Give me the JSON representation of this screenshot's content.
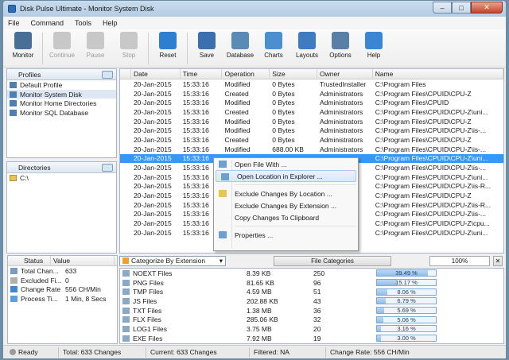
{
  "window": {
    "title": "Disk Pulse Ultimate - Monitor System Disk"
  },
  "menu": [
    "File",
    "Command",
    "Tools",
    "Help"
  ],
  "toolbar": [
    {
      "label": "Monitor",
      "icon": "monitor-icon",
      "enabled": true,
      "color": "#4a6f96"
    },
    {
      "label": "Continue",
      "icon": "play-icon",
      "enabled": false
    },
    {
      "label": "Pause",
      "icon": "pause-icon",
      "enabled": false
    },
    {
      "label": "Stop",
      "icon": "stop-icon",
      "enabled": false
    },
    {
      "label": "Reset",
      "icon": "reset-icon",
      "enabled": true,
      "color": "#2f7fd0"
    },
    {
      "label": "Save",
      "icon": "save-icon",
      "enabled": true,
      "color": "#3a6fb0"
    },
    {
      "label": "Database",
      "icon": "database-icon",
      "enabled": true,
      "color": "#5a8ab6"
    },
    {
      "label": "Charts",
      "icon": "charts-icon",
      "enabled": true,
      "color": "#4c8fd1"
    },
    {
      "label": "Layouts",
      "icon": "layouts-icon",
      "enabled": true,
      "color": "#3d7cc0"
    },
    {
      "label": "Options",
      "icon": "options-icon",
      "enabled": true,
      "color": "#5a7fa6"
    },
    {
      "label": "Help",
      "icon": "help-icon",
      "enabled": true,
      "color": "#3a86d4"
    }
  ],
  "profiles": {
    "header": "Profiles",
    "items": [
      "Default Profile",
      "Monitor System Disk",
      "Monitor Home Directories",
      "Monitor SQL Database"
    ],
    "selected": 1
  },
  "directories": {
    "header": "Directories",
    "items": [
      "C:\\"
    ]
  },
  "grid": {
    "columns": [
      "Date",
      "Time",
      "Operation",
      "Size",
      "Owner",
      "Name"
    ],
    "rows": [
      {
        "status": "yellow",
        "date": "20-Jan-2015",
        "time": "15:33:16",
        "op": "Modified",
        "size": "0 Bytes",
        "owner": "TrustedInstaller",
        "name": "C:\\Program Files"
      },
      {
        "status": "green",
        "date": "20-Jan-2015",
        "time": "15:33:16",
        "op": "Created",
        "size": "0 Bytes",
        "owner": "Administrators",
        "name": "C:\\Program Files\\CPUID\\CPU-Z"
      },
      {
        "status": "yellow",
        "date": "20-Jan-2015",
        "time": "15:33:16",
        "op": "Modified",
        "size": "0 Bytes",
        "owner": "Administrators",
        "name": "C:\\Program Files\\CPUID"
      },
      {
        "status": "green",
        "date": "20-Jan-2015",
        "time": "15:33:16",
        "op": "Created",
        "size": "0 Bytes",
        "owner": "Administrators",
        "name": "C:\\Program Files\\CPUID\\CPU-Z\\uni..."
      },
      {
        "status": "yellow",
        "date": "20-Jan-2015",
        "time": "15:33:16",
        "op": "Modified",
        "size": "0 Bytes",
        "owner": "Administrators",
        "name": "C:\\Program Files\\CPUID\\CPU-Z"
      },
      {
        "status": "yellow",
        "date": "20-Jan-2015",
        "time": "15:33:16",
        "op": "Modified",
        "size": "0 Bytes",
        "owner": "Administrators",
        "name": "C:\\Program Files\\CPUID\\CPU-Z\\is-..."
      },
      {
        "status": "green",
        "date": "20-Jan-2015",
        "time": "15:33:16",
        "op": "Created",
        "size": "0 Bytes",
        "owner": "Administrators",
        "name": "C:\\Program Files\\CPUID\\CPU-Z"
      },
      {
        "status": "yellow",
        "date": "20-Jan-2015",
        "time": "15:33:16",
        "op": "Modified",
        "size": "688.00 KB",
        "owner": "Administrators",
        "name": "C:\\Program Files\\CPUID\\CPU-Z\\is-..."
      },
      {
        "status": "orange",
        "date": "20-Jan-2015",
        "time": "15:33:16",
        "op": "",
        "size": "",
        "owner": "",
        "name": "C:\\Program Files\\CPUID\\CPU-Z\\uni...",
        "selected": true
      },
      {
        "status": "green",
        "date": "20-Jan-2015",
        "time": "15:33:16",
        "op": "",
        "size": "",
        "owner": "",
        "name": "C:\\Program Files\\CPUID\\CPU-Z\\is-..."
      },
      {
        "status": "green",
        "date": "20-Jan-2015",
        "time": "15:33:16",
        "op": "",
        "size": "",
        "owner": "",
        "name": "C:\\Program Files\\CPUID\\CPU-Z\\uni..."
      },
      {
        "status": "green",
        "date": "20-Jan-2015",
        "time": "15:33:16",
        "op": "",
        "size": "",
        "owner": "",
        "name": "C:\\Program Files\\CPUID\\CPU-Z\\is-R..."
      },
      {
        "status": "green",
        "date": "20-Jan-2015",
        "time": "15:33:16",
        "op": "",
        "size": "",
        "owner": "",
        "name": "C:\\Program Files\\CPUID\\CPU-Z"
      },
      {
        "status": "orange",
        "date": "20-Jan-2015",
        "time": "15:33:16",
        "op": "",
        "size": "",
        "owner": "",
        "name": "C:\\Program Files\\CPUID\\CPU-Z\\is-R..."
      },
      {
        "status": "orange",
        "date": "20-Jan-2015",
        "time": "15:33:16",
        "op": "",
        "size": "",
        "owner": "",
        "name": "C:\\Program Files\\CPUID\\CPU-Z\\is-..."
      },
      {
        "status": "yellow",
        "date": "20-Jan-2015",
        "time": "15:33:16",
        "op": "",
        "size": "",
        "owner": "",
        "name": "C:\\Program Files\\CPUID\\CPU-Z\\cpu..."
      },
      {
        "status": "yellow",
        "date": "20-Jan-2015",
        "time": "15:33:16",
        "op": "",
        "size": "",
        "owner": "",
        "name": "C:\\Program Files\\CPUID\\CPU-Z\\uni..."
      }
    ]
  },
  "context_menu": [
    {
      "label": "Open File With ...",
      "icon": "open-file-icon"
    },
    {
      "label": "Open Location in Explorer ...",
      "icon": "folder-open-icon",
      "hot": true
    },
    {
      "sep": true
    },
    {
      "label": "Exclude Changes By Location ...",
      "icon": "exclude-folder-icon"
    },
    {
      "label": "Exclude Changes By Extension ..."
    },
    {
      "label": "Copy Changes To Clipboard"
    },
    {
      "sep": true
    },
    {
      "label": "Properties ...",
      "icon": "properties-icon"
    }
  ],
  "stats": {
    "headers": [
      "Status",
      "Value"
    ],
    "rows": [
      {
        "icon": "total-changes-icon",
        "label": "Total Chan...",
        "value": "633"
      },
      {
        "icon": "excluded-files-icon",
        "label": "Excluded Fi...",
        "value": "0"
      },
      {
        "icon": "change-rate-icon",
        "label": "Change Rate",
        "value": "556 CH/Min"
      },
      {
        "icon": "process-time-icon",
        "label": "Process Ti...",
        "value": "1 Min, 8 Secs"
      }
    ]
  },
  "categories_bar": {
    "select_value": "Categorize By Extension",
    "button": "File Categories",
    "zoom": "100%"
  },
  "categories": [
    {
      "name": "NOEXT Files",
      "size": "8.39 KB",
      "count": "250",
      "percent": 39.49,
      "label": "39.49 %"
    },
    {
      "name": "PNG Files",
      "size": "81.65 KB",
      "count": "96",
      "percent": 15.17,
      "label": "15.17 %"
    },
    {
      "name": "TMP Files",
      "size": "4.59 MB",
      "count": "51",
      "percent": 8.06,
      "label": "8.06 %"
    },
    {
      "name": "JS Files",
      "size": "202.88 KB",
      "count": "43",
      "percent": 6.79,
      "label": "6.79 %"
    },
    {
      "name": "TXT Files",
      "size": "1.38 MB",
      "count": "36",
      "percent": 5.69,
      "label": "5.69 %"
    },
    {
      "name": "FLX Files",
      "size": "285.06 KB",
      "count": "32",
      "percent": 5.06,
      "label": "5.06 %"
    },
    {
      "name": "LOG1 Files",
      "size": "3.75 MB",
      "count": "20",
      "percent": 3.16,
      "label": "3.16 %"
    },
    {
      "name": "EXE Files",
      "size": "7.92 MB",
      "count": "19",
      "percent": 3.0,
      "label": "3.00 %"
    }
  ],
  "status": {
    "state": "Ready",
    "total": "Total: 633 Changes",
    "current": "Current: 633 Changes",
    "filtered": "Filtered: NA",
    "rate": "Change Rate: 556 CH/Min"
  },
  "colors": {
    "selection": "#3399ff",
    "yellow": "#f2c01e",
    "green": "#3cab3c",
    "orange": "#ef7d22"
  }
}
